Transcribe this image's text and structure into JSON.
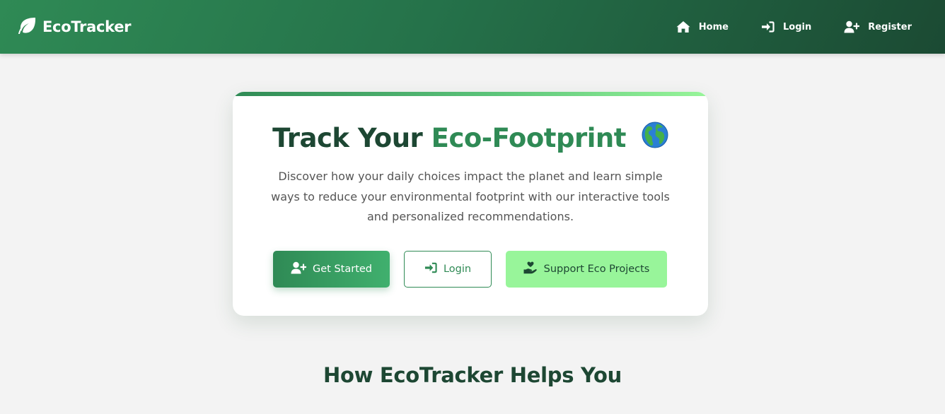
{
  "navbar": {
    "brand": "EcoTracker",
    "brand_icon": "leaf-icon",
    "links": [
      {
        "label": "Home",
        "icon": "home-icon"
      },
      {
        "label": "Login",
        "icon": "sign-in-icon"
      },
      {
        "label": "Register",
        "icon": "user-plus-icon"
      }
    ]
  },
  "hero": {
    "title_part1": "Track Your ",
    "title_accent": "Eco-Footprint",
    "title_emoji_icon": "globe-icon",
    "description": "Discover how your daily choices impact the planet and learn simple ways to reduce your environmental footprint with our interactive tools and personalized recommendations.",
    "buttons": [
      {
        "label": "Get Started",
        "icon": "user-plus-icon"
      },
      {
        "label": "Login",
        "icon": "sign-in-icon"
      },
      {
        "label": "Support Eco Projects",
        "icon": "hand-holding-heart-icon"
      }
    ]
  },
  "section": {
    "title": "How EcoTracker Helps You"
  },
  "colors": {
    "primary": "#2f8a55",
    "dark": "#1d4733",
    "light_accent": "#98f59a",
    "background": "#f3f3f3"
  }
}
